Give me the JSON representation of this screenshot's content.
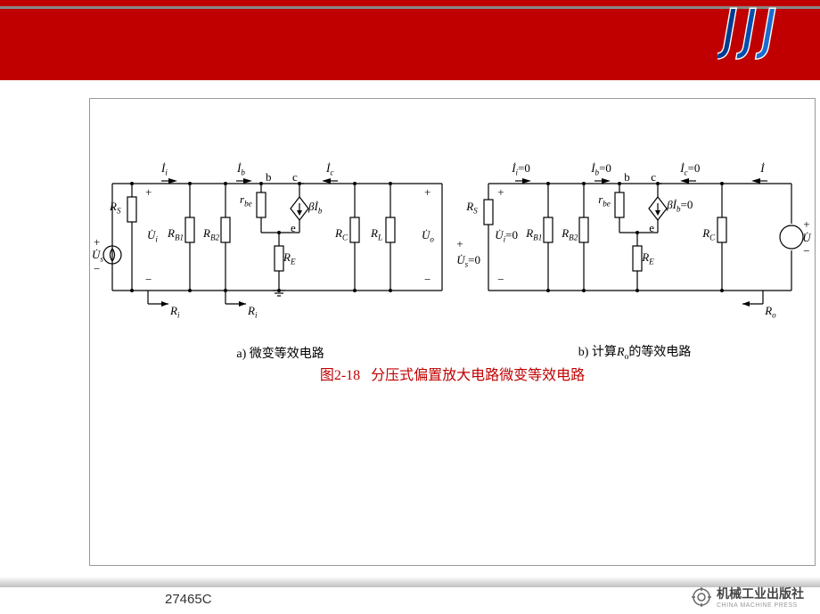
{
  "header": {
    "logo_text": "JJJ"
  },
  "figure": {
    "caption_prefix": "图2-18",
    "caption_text": "分压式偏置放大电路微变等效电路",
    "sub_a": "a) 微变等效电路",
    "sub_b_prefix": "b) 计算",
    "sub_b_var": "R",
    "sub_b_sub": "o",
    "sub_b_suffix": "的等效电路"
  },
  "circuit_a": {
    "Ii": "İ",
    "Ii_sub": "i",
    "Ib": "İ",
    "Ib_sub": "b",
    "Ic": "İ",
    "Ic_sub": "c",
    "node_b": "b",
    "node_c": "c",
    "node_e": "e",
    "Rs": "R",
    "Rs_sub": "S",
    "Ui": "U̇",
    "Ui_sub": "i",
    "Us": "U̇",
    "Us_sub": "s",
    "RB1": "R",
    "RB1_sub": "B1",
    "RB2": "R",
    "RB2_sub": "B2",
    "rbe": "r",
    "rbe_sub": "be",
    "RE": "R",
    "RE_sub": "E",
    "beta": "βİ",
    "beta_sub": "b",
    "RC": "R",
    "RC_sub": "C",
    "RL": "R",
    "RL_sub": "L",
    "Uo": "U̇",
    "Uo_sub": "o",
    "Ri_arrow": "R",
    "Ri_sub": "i",
    "plus": "+",
    "minus": "−"
  },
  "circuit_b": {
    "Ii_zero": "İ",
    "Ii_sub": "i",
    "zero": "=0",
    "Ib_zero": "İ",
    "Ib_sub": "b",
    "Ic_zero": "İ",
    "Ic_sub": "c",
    "I_out": "İ",
    "node_b": "b",
    "node_c": "c",
    "node_e": "e",
    "Rs": "R",
    "Rs_sub": "S",
    "Ui_zero": "U̇",
    "Ui_sub": "i",
    "Us_zero": "U̇",
    "Us_sub": "s",
    "RB1": "R",
    "RB1_sub": "B1",
    "RB2": "R",
    "RB2_sub": "B2",
    "rbe": "r",
    "rbe_sub": "be",
    "RE": "R",
    "RE_sub": "E",
    "beta": "βİ",
    "beta_sub": "b",
    "RC": "R",
    "RC_sub": "C",
    "U_out": "U̇",
    "Ro_arrow": "R",
    "Ro_sub": "o",
    "plus": "+",
    "minus": "−"
  },
  "footer": {
    "code": "27465C",
    "publisher_name": "机械工业出版社",
    "publisher_en": "CHINA MACHINE PRESS"
  }
}
